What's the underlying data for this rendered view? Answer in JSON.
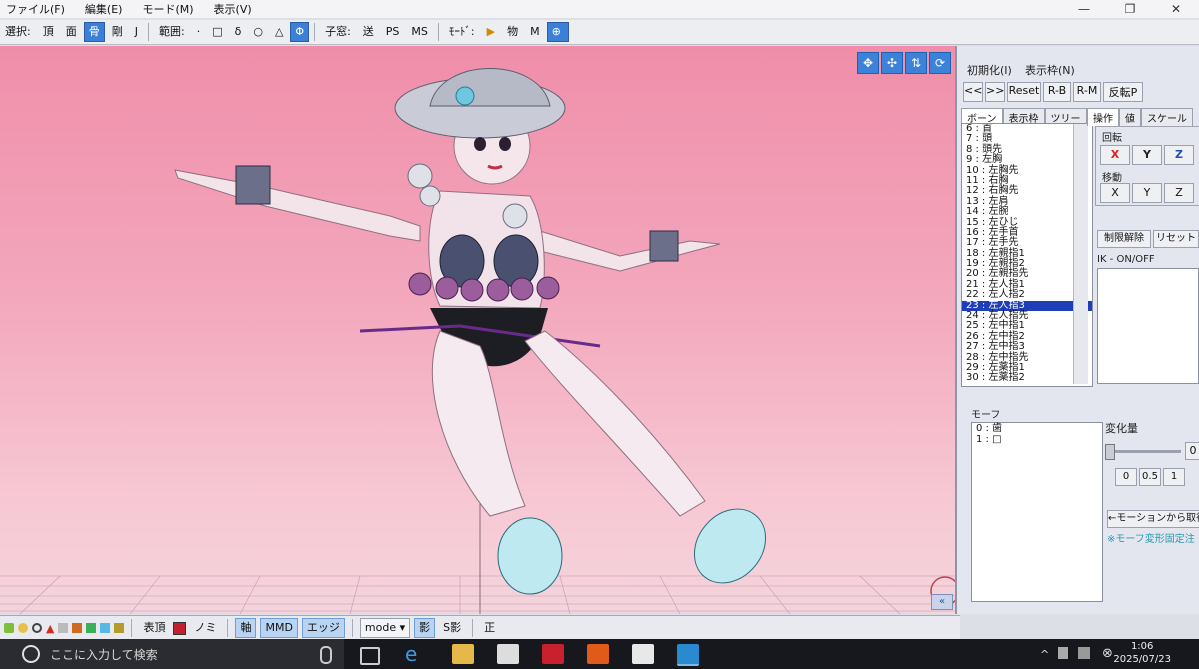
{
  "menu": {
    "items": [
      "ファイル(F)",
      "編集(E)",
      "モード(M)",
      "表示(V)"
    ]
  },
  "toolbar": {
    "select_label": "選択:",
    "select_items": [
      "頂",
      "面",
      "骨",
      "剛",
      "J"
    ],
    "range_label": "範囲:",
    "range_items": [
      "·",
      "□",
      "δ",
      "○",
      "△",
      "Φ"
    ],
    "child_label": "子窓:",
    "child_items": [
      "送",
      "PS",
      "MS"
    ],
    "mode_label": "ﾓｰﾄﾞ:",
    "mode_items": [
      "▶",
      "物",
      "M"
    ]
  },
  "right_panel": {
    "init_label": "初期化(I)",
    "frame_label": "表示枠(N)",
    "nav_buttons": [
      "<<",
      ">>",
      "Reset",
      "R-B",
      "R-M",
      "反転P"
    ],
    "list_tabs": [
      "ボーン",
      "表示枠",
      "ツリー"
    ],
    "op_tabs": [
      "操作",
      "値",
      "スケール"
    ],
    "rotate_label": "回転",
    "move_label": "移動",
    "xyz": [
      "X",
      "Y",
      "Z"
    ],
    "unlock_button": "制限解除",
    "reset_button": "リセット",
    "ik_label": "IK - ON/OFF",
    "bones": [
      "6 : 首",
      "7 : 頭",
      "8 : 頭先",
      "9 : 左胸",
      "10 : 左胸先",
      "11 : 右胸",
      "12 : 右胸先",
      "13 : 左肩",
      "14 : 左腕",
      "15 : 左ひじ",
      "16 : 左手首",
      "17 : 左手先",
      "18 : 左親指1",
      "19 : 左親指2",
      "20 : 左親指先",
      "21 : 左人指1",
      "22 : 左人指2",
      "23 : 左人指3",
      "24 : 左人指先",
      "25 : 左中指1",
      "26 : 左中指2",
      "27 : 左中指3",
      "28 : 左中指先",
      "29 : 左薬指1",
      "30 : 左薬指2"
    ],
    "selected_bone_index": 17,
    "morph_label": "モーフ",
    "morphs": [
      "0 : 歯",
      "1 : □"
    ],
    "change_label": "変化量",
    "change_value": "0",
    "preset_values": [
      "0",
      "0.5",
      "1"
    ],
    "get_from_motion": "←モーションから取得",
    "morph_note": "※モーフ変形固定注"
  },
  "bottom_bar": {
    "items": [
      "表頂",
      "ノミ",
      "軸",
      "MMD",
      "エッジ",
      "mode",
      "影",
      "S影",
      "正"
    ]
  },
  "taskbar": {
    "search_placeholder": "ここに入力して検索",
    "time": "1:06",
    "date": "2025/07/23"
  },
  "colors": {
    "viewport_top": "#f08eaa",
    "accent_blue": "#3b82d8",
    "selected_row": "#1f3fb8"
  }
}
